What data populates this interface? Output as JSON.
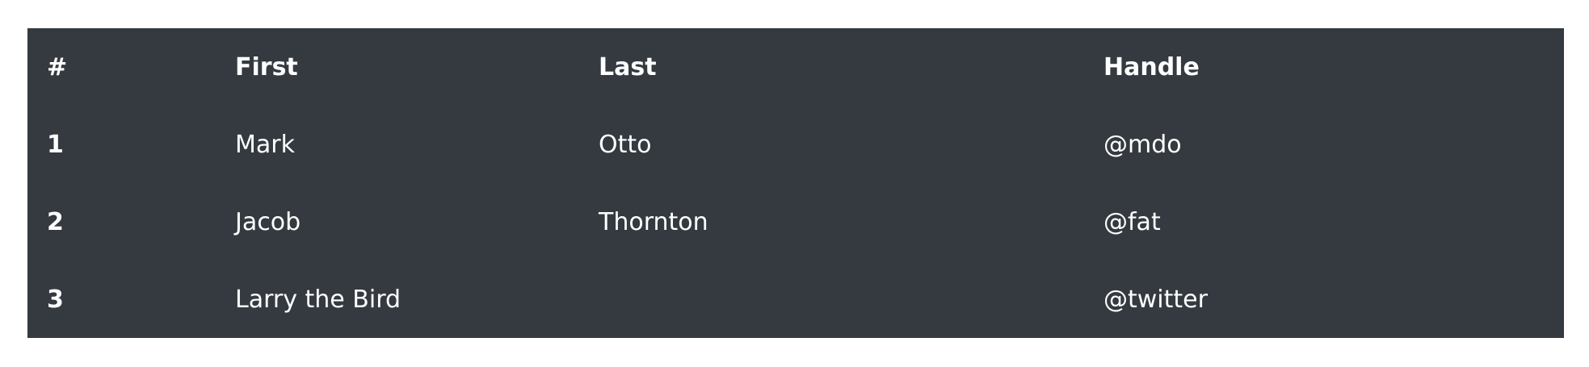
{
  "table": {
    "columns": [
      "#",
      "First",
      "Last",
      "Handle"
    ],
    "rows": [
      {
        "num": "1",
        "first": "Mark",
        "last": "Otto",
        "handle": "@mdo"
      },
      {
        "num": "2",
        "first": "Jacob",
        "last": "Thornton",
        "handle": "@fat"
      },
      {
        "num": "3",
        "first": "Larry the Bird",
        "last": "",
        "handle": "@twitter"
      }
    ],
    "colors": {
      "background": "#343a40",
      "text": "#ffffff",
      "page_background": "#ffffff"
    }
  }
}
